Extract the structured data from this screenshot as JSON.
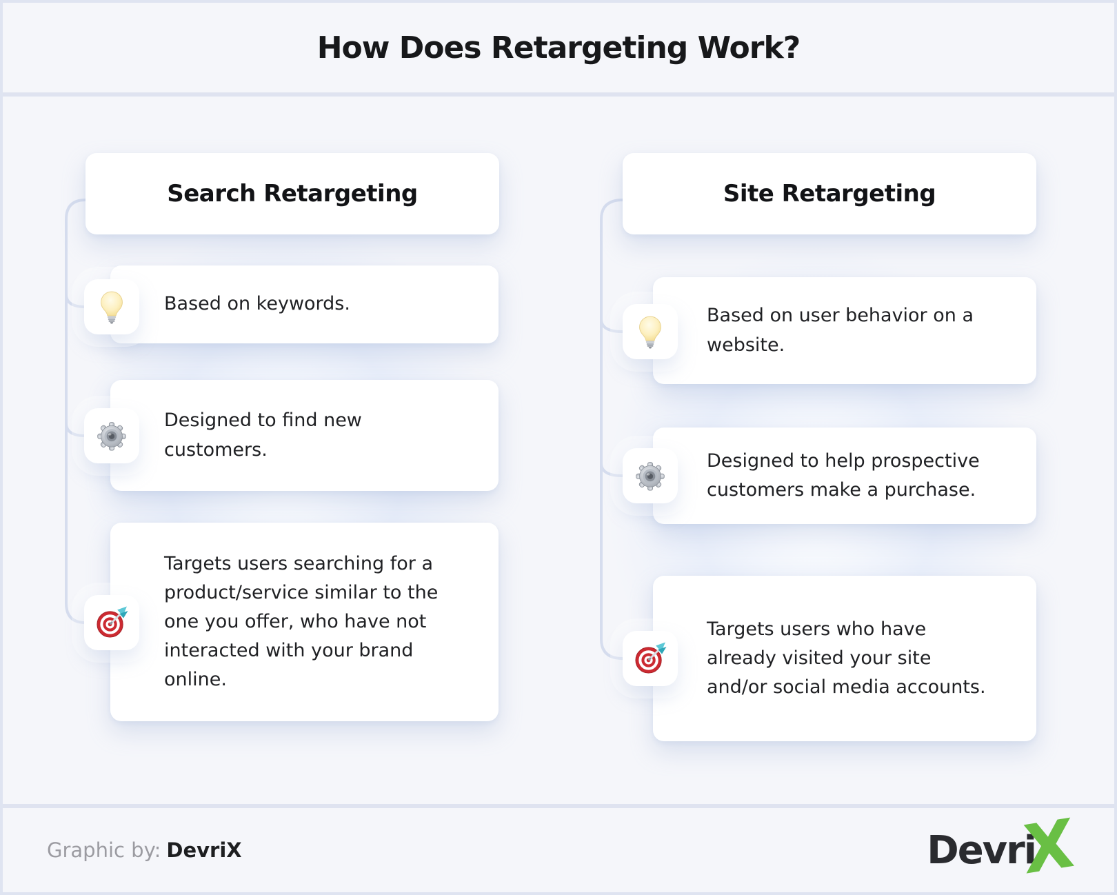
{
  "title": "How Does Retargeting Work?",
  "columns": [
    {
      "header": "Search Retargeting",
      "items": [
        {
          "icon": "lightbulb-icon",
          "text": "Based on keywords."
        },
        {
          "icon": "gear-icon",
          "text": "Designed to find new customers."
        },
        {
          "icon": "target-icon",
          "text": "Targets users searching for a product/service similar to the one you offer, who have not interacted with your brand online."
        }
      ]
    },
    {
      "header": "Site Retargeting",
      "items": [
        {
          "icon": "lightbulb-icon",
          "text": "Based on user behavior on a website."
        },
        {
          "icon": "gear-icon",
          "text": "Designed to help prospective customers make a purchase."
        },
        {
          "icon": "target-icon",
          "text": "Targets users who have already visited your site and/or social media accounts."
        }
      ]
    }
  ],
  "footer": {
    "credit_label": "Graphic by:",
    "credit_name": "DevriX",
    "logo_text": "Devri",
    "logo_x": "X"
  },
  "colors": {
    "background": "#f5f6fa",
    "card": "#ffffff",
    "divider": "#dfe3f0",
    "connector": "#d6ddee",
    "text": "#202124",
    "muted_text": "#9b9ba1",
    "accent_green": "#69bf44",
    "target_red": "#cc2a31",
    "bulb_yellow": "#f5dd8f",
    "gear_gray": "#9aa0a9"
  }
}
